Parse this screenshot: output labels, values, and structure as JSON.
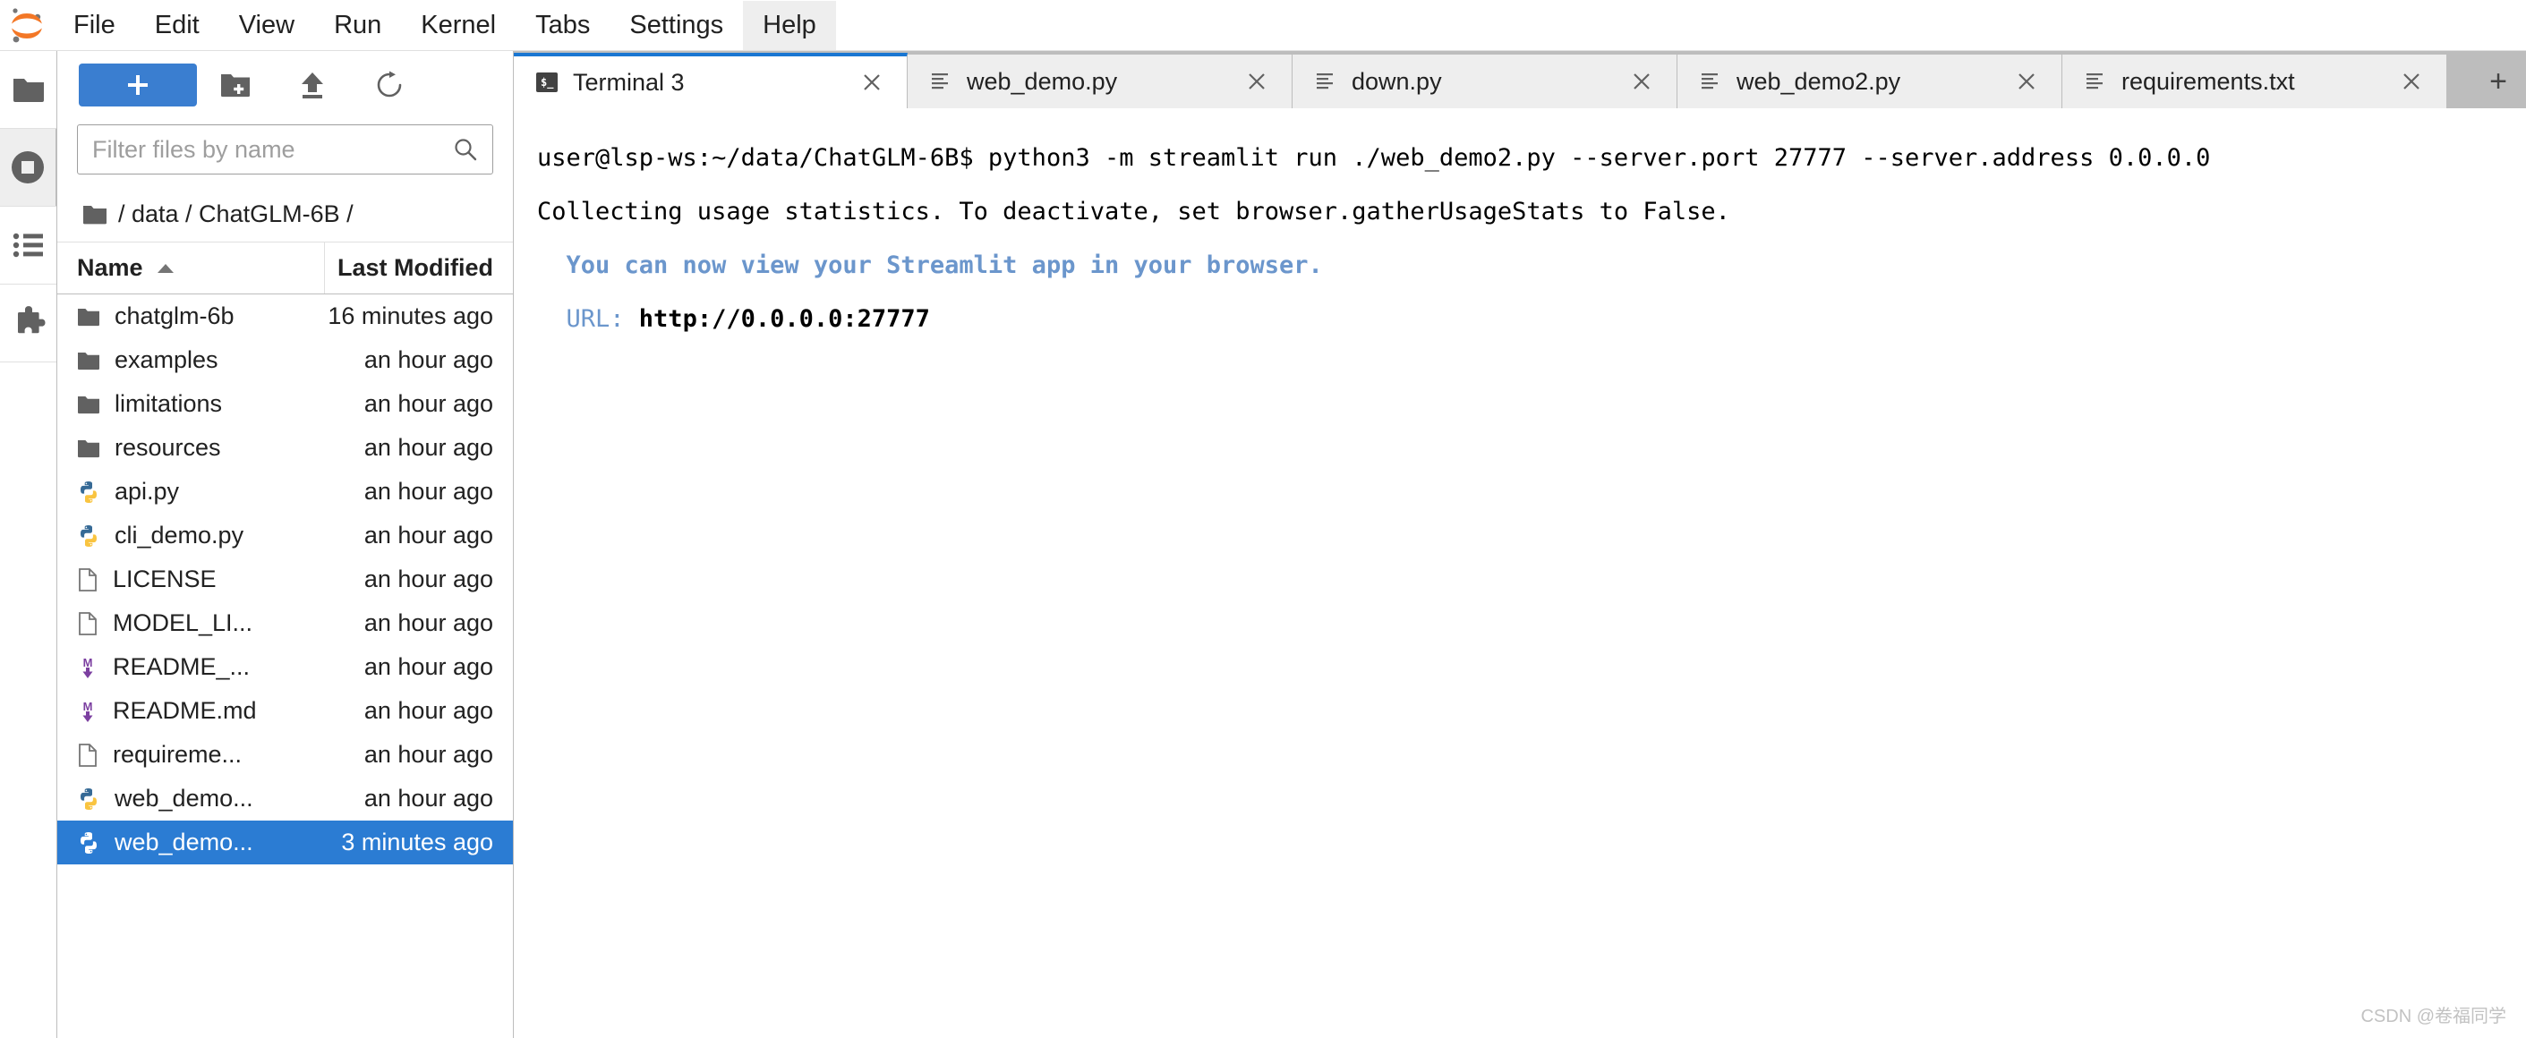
{
  "app": {
    "logo_icon": "jupyter-logo-icon",
    "watermark": "CSDN @卷福同学"
  },
  "menubar": {
    "items": [
      {
        "label": "File",
        "active": false
      },
      {
        "label": "Edit",
        "active": false
      },
      {
        "label": "View",
        "active": false
      },
      {
        "label": "Run",
        "active": false
      },
      {
        "label": "Kernel",
        "active": false
      },
      {
        "label": "Tabs",
        "active": false
      },
      {
        "label": "Settings",
        "active": false
      },
      {
        "label": "Help",
        "active": true
      }
    ]
  },
  "activitybar": {
    "items": [
      {
        "name": "file-browser-icon",
        "selected": false
      },
      {
        "name": "running-terminals-icon",
        "selected": true
      },
      {
        "name": "table-of-contents-icon",
        "selected": false
      },
      {
        "name": "extension-manager-icon",
        "selected": false
      }
    ]
  },
  "filebrowser": {
    "toolbar": {
      "new_launcher_label": "+",
      "new_folder_icon": "new-folder-icon",
      "upload_icon": "upload-icon",
      "refresh_icon": "refresh-icon"
    },
    "filter": {
      "placeholder": "Filter files by name",
      "value": "",
      "search_icon": "search-icon"
    },
    "breadcrumb": {
      "root_icon": "folder-icon",
      "path": "/ data / ChatGLM-6B /"
    },
    "columns": {
      "name": "Name",
      "sort_icon": "sort-ascending-icon",
      "last_modified": "Last Modified"
    },
    "rows": [
      {
        "name": "chatglm-6b",
        "modified": "16 minutes ago",
        "icon": "folder-icon",
        "selected": false
      },
      {
        "name": "examples",
        "modified": "an hour ago",
        "icon": "folder-icon",
        "selected": false
      },
      {
        "name": "limitations",
        "modified": "an hour ago",
        "icon": "folder-icon",
        "selected": false
      },
      {
        "name": "resources",
        "modified": "an hour ago",
        "icon": "folder-icon",
        "selected": false
      },
      {
        "name": "api.py",
        "modified": "an hour ago",
        "icon": "python-icon",
        "selected": false
      },
      {
        "name": "cli_demo.py",
        "modified": "an hour ago",
        "icon": "python-icon",
        "selected": false
      },
      {
        "name": "LICENSE",
        "modified": "an hour ago",
        "icon": "file-icon",
        "selected": false
      },
      {
        "name": "MODEL_LI...",
        "modified": "an hour ago",
        "icon": "file-icon",
        "selected": false
      },
      {
        "name": "README_...",
        "modified": "an hour ago",
        "icon": "markdown-icon",
        "selected": false
      },
      {
        "name": "README.md",
        "modified": "an hour ago",
        "icon": "markdown-icon",
        "selected": false
      },
      {
        "name": "requireme...",
        "modified": "an hour ago",
        "icon": "file-icon",
        "selected": false
      },
      {
        "name": "web_demo...",
        "modified": "an hour ago",
        "icon": "python-icon",
        "selected": false
      },
      {
        "name": "web_demo...",
        "modified": "3 minutes ago",
        "icon": "python-icon",
        "selected": true
      }
    ]
  },
  "tabs": {
    "items": [
      {
        "label": "Terminal 3",
        "icon": "terminal-icon",
        "active": true,
        "close_icon": "close-icon"
      },
      {
        "label": "web_demo.py",
        "icon": "text-file-icon",
        "active": false,
        "close_icon": "close-icon"
      },
      {
        "label": "down.py",
        "icon": "text-file-icon",
        "active": false,
        "close_icon": "close-icon"
      },
      {
        "label": "web_demo2.py",
        "icon": "text-file-icon",
        "active": false,
        "close_icon": "close-icon"
      },
      {
        "label": "requirements.txt",
        "icon": "text-file-icon",
        "active": false,
        "close_icon": "close-icon"
      }
    ],
    "add_tab_label": "+"
  },
  "terminal": {
    "lines": [
      {
        "text": "user@lsp-ws:~/data/ChatGLM-6B$ python3 -m streamlit run ./web_demo2.py --server.port 27777 --server.address 0.0.0.0",
        "style": "plain"
      },
      {
        "text": "",
        "style": "plain"
      },
      {
        "text": "Collecting usage statistics. To deactivate, set browser.gatherUsageStats to False.",
        "style": "plain"
      },
      {
        "text": "",
        "style": "plain"
      },
      {
        "text": "",
        "style": "plain"
      },
      {
        "text": "  You can now view your Streamlit app in your browser.",
        "style": "blue-bold"
      },
      {
        "text": "",
        "style": "plain"
      },
      {
        "text": "  URL: http://0.0.0.0:27777",
        "style": "url-line",
        "url_label": "  URL: ",
        "url_value": "http://0.0.0.0:27777"
      }
    ]
  }
}
